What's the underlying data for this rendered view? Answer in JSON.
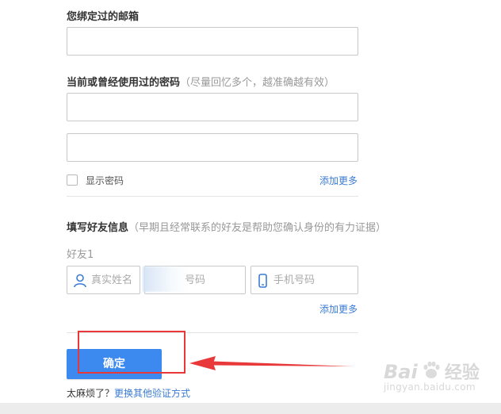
{
  "email_section": {
    "label": "您绑定过的邮箱",
    "value": ""
  },
  "password_section": {
    "label": "当前或曾经使用过的密码",
    "hint": "（尽量回忆多个，越准确越有效）",
    "value1": "",
    "value2": "",
    "show_password_label": "显示密码",
    "add_more_label": "添加更多"
  },
  "friend_section": {
    "label": "填写好友信息",
    "hint": "（早期且经常联系的好友是帮助您确认身份的有力证据）",
    "friend1_label": "好友1",
    "name_placeholder": "真实姓名",
    "qq_placeholder": "号码",
    "phone_placeholder": "手机号码",
    "add_more_label": "添加更多"
  },
  "actions": {
    "confirm_label": "确定",
    "too_troublesome_text": "太麻烦了？",
    "other_method_link": "更换其他验证方式"
  },
  "watermark": {
    "brand": "Bai",
    "brand_suffix": "经验",
    "url": "jingyan.baidu.com"
  },
  "colors": {
    "primary_button": "#3c8af0",
    "link": "#3a7bd5",
    "annotation_red": "#e8383a"
  }
}
